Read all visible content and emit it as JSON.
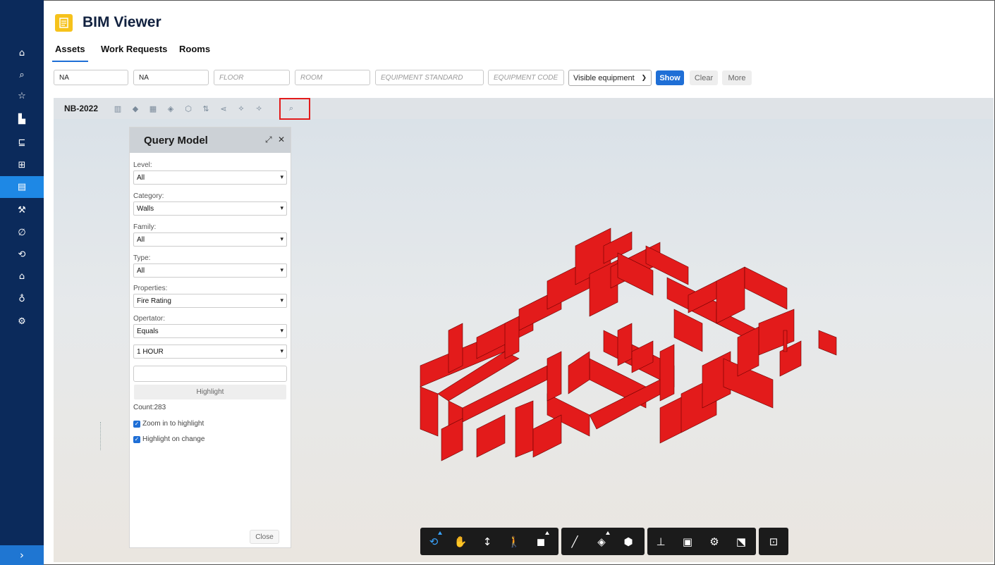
{
  "app": {
    "title": "BIM Viewer",
    "logo_icon": "document-icon",
    "accent_color": "#f6c21b"
  },
  "sidebar": {
    "items": [
      {
        "icon": "home-icon",
        "glyph": "⌂"
      },
      {
        "icon": "search-icon",
        "glyph": "⌕"
      },
      {
        "icon": "star-icon",
        "glyph": "☆"
      },
      {
        "icon": "buildings-icon",
        "glyph": "▙"
      },
      {
        "icon": "hierarchy-icon",
        "glyph": "⊑"
      },
      {
        "icon": "floorplan-icon",
        "glyph": "⊞"
      },
      {
        "icon": "bim-icon",
        "glyph": "▤"
      },
      {
        "icon": "wrench-icon",
        "glyph": "⚒"
      },
      {
        "icon": "leaf-icon",
        "glyph": "∅"
      },
      {
        "icon": "sync-icon",
        "glyph": "⟲"
      },
      {
        "icon": "badge-icon",
        "glyph": "⌂"
      },
      {
        "icon": "bulb-icon",
        "glyph": "♁"
      },
      {
        "icon": "gear-icon",
        "glyph": "⚙"
      }
    ],
    "active_index": 6,
    "expand_glyph": "›"
  },
  "tabs": [
    {
      "label": "Assets"
    },
    {
      "label": "Work Requests"
    },
    {
      "label": "Rooms"
    }
  ],
  "filters": {
    "building": {
      "value": "NA"
    },
    "site": {
      "value": "NA"
    },
    "floor": {
      "placeholder": "FLOOR"
    },
    "room": {
      "placeholder": "ROOM"
    },
    "equipment_standard": {
      "placeholder": "EQUIPMENT STANDARD"
    },
    "equipment_code": {
      "placeholder": "EQUIPMENT CODE"
    },
    "visibility": {
      "selected": "Visible equipment"
    },
    "show_label": "Show",
    "clear_label": "Clear",
    "more_label": "More"
  },
  "viewer": {
    "model_name": "NB-2022",
    "tools": [
      "properties-icon",
      "layers-icon",
      "grid-icon",
      "tag-icon",
      "cube-icon",
      "sort-icon",
      "share-icon",
      "section-icon",
      "explode-icon",
      "search-icon"
    ],
    "highlight_color": "#e31b1b"
  },
  "query_panel": {
    "title": "Query Model",
    "expand_glyph": "⤢",
    "close_glyph": "✕",
    "fields": [
      {
        "label": "Level:",
        "value": "All"
      },
      {
        "label": "Category:",
        "value": "Walls"
      },
      {
        "label": "Family:",
        "value": "All"
      },
      {
        "label": "Type:",
        "value": "All"
      },
      {
        "label": "Properties:",
        "value": "Fire Rating"
      },
      {
        "label": "Opertator:",
        "value": "Equals"
      }
    ],
    "value_select": "1 HOUR",
    "highlight_label": "Highlight",
    "count_text": "Count:283",
    "zoom_label": "Zoom in to highlight",
    "highlight_change_label": "Highlight on change",
    "close_label": "Close"
  },
  "bottom_toolbar": {
    "groups": [
      [
        "orbit-icon",
        "pan-icon",
        "dolly-icon",
        "walk-icon",
        "camera-icon"
      ],
      [
        "measure-icon",
        "section-box-icon",
        "explode-icon"
      ],
      [
        "model-tree-icon",
        "properties-icon",
        "settings-icon",
        "fullscreen-icon"
      ],
      [
        "view-cube-icon"
      ]
    ],
    "active": "orbit-icon"
  }
}
